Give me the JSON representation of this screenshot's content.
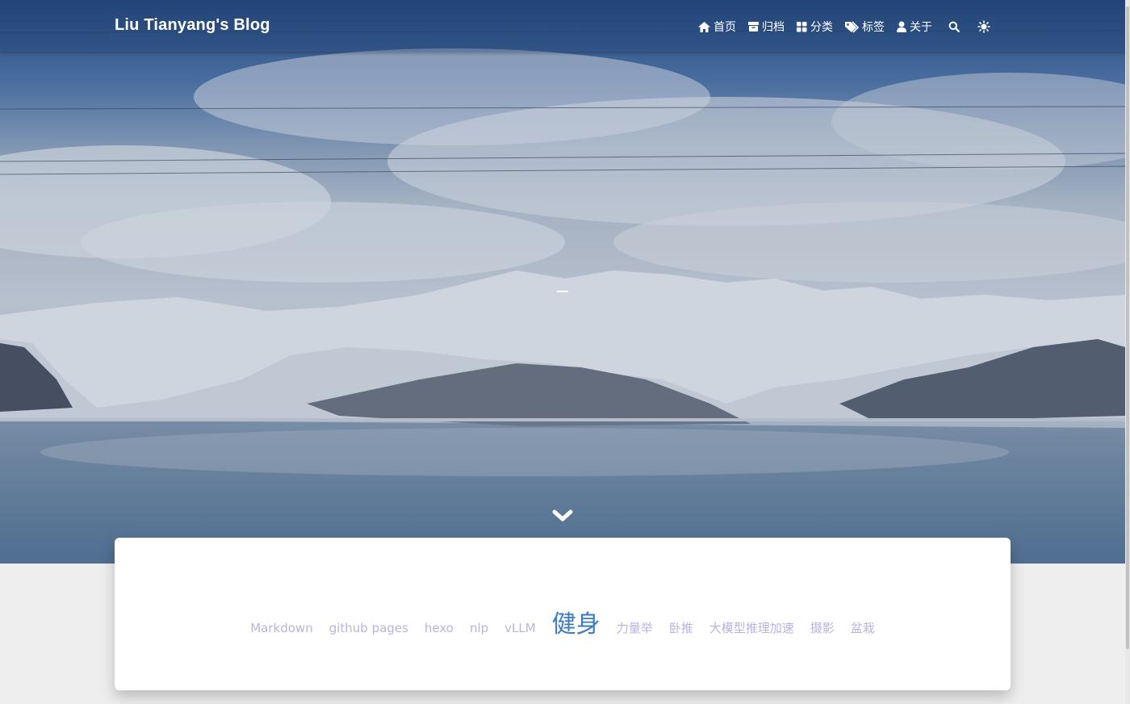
{
  "navbar": {
    "brand": "Liu Tianyang's Blog",
    "items": [
      {
        "label": "首页",
        "icon": "home-icon"
      },
      {
        "label": "归档",
        "icon": "archive-icon"
      },
      {
        "label": "分类",
        "icon": "category-icon"
      },
      {
        "label": "标签",
        "icon": "tags-icon"
      },
      {
        "label": "关于",
        "icon": "user-icon"
      }
    ],
    "search_icon": "search-icon",
    "theme_icon": "sun-icon"
  },
  "hero": {
    "scroll_icon": "chevron-down-icon"
  },
  "tag_cloud": {
    "tags": [
      {
        "label": "Markdown"
      },
      {
        "label": "github pages"
      },
      {
        "label": "hexo"
      },
      {
        "label": "nlp"
      },
      {
        "label": "vLLM"
      },
      {
        "label": "健身",
        "size": "large"
      },
      {
        "label": "力量举"
      },
      {
        "label": "卧推"
      },
      {
        "label": "大模型推理加速"
      },
      {
        "label": "摄影"
      },
      {
        "label": "盆栽"
      }
    ]
  },
  "colors": {
    "tag_default": "#b7b4e0",
    "tag_highlight": "#3b7bbf",
    "page_background": "#eeeeee"
  }
}
